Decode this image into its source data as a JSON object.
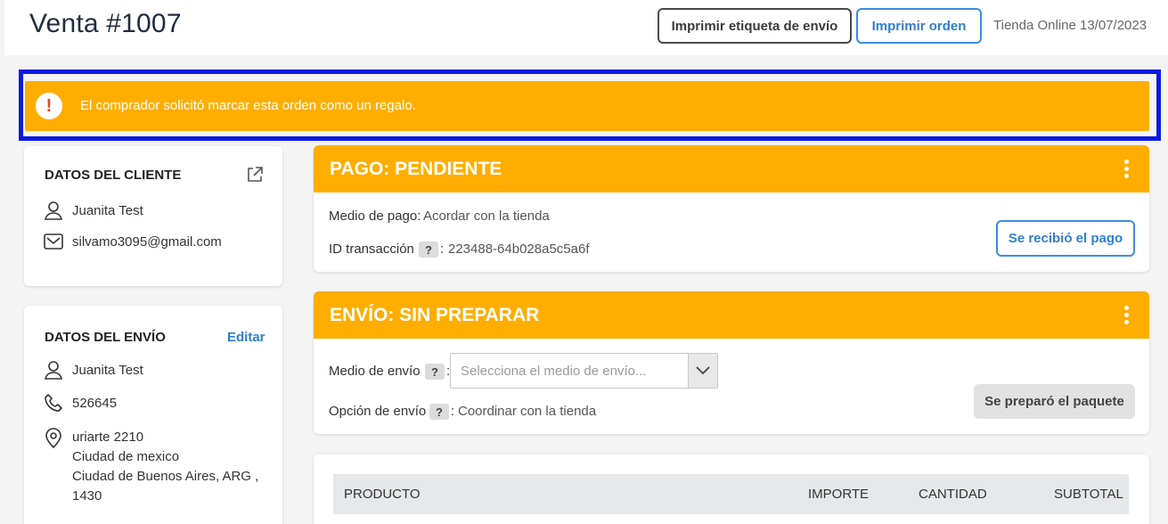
{
  "header": {
    "title": "Venta #1007",
    "print_label_button": "Imprimir etiqueta de envío",
    "print_order_button": "Imprimir orden",
    "store_date": "Tienda Online 13/07/2023"
  },
  "alert": {
    "icon": "!",
    "text": "El comprador solicitó marcar esta orden como un regalo."
  },
  "customer": {
    "heading": "DATOS DEL CLIENTE",
    "name": "Juanita Test",
    "email": "silvamo3095@gmail.com"
  },
  "shipping_data": {
    "heading": "DATOS DEL ENVÍO",
    "edit_link": "Editar",
    "name": "Juanita Test",
    "phone": "526645",
    "address_line1": "uriarte 2210",
    "address_line2": "Ciudad de mexico",
    "address_line3": "Ciudad de Buenos Aires, ARG ,",
    "address_line4": "1430"
  },
  "payment": {
    "title": "PAGO: PENDIENTE",
    "method_label": "Medio de pago:",
    "method_value": "Acordar con la tienda",
    "txn_label": "ID transacción",
    "help": "?",
    "colon": ":",
    "txn_value": "223488-64b028a5c5a6f",
    "received_button": "Se recibió el pago"
  },
  "shipment": {
    "title": "ENVÍO: SIN PREPARAR",
    "method_label": "Medio de envío",
    "help": "?",
    "colon": ":",
    "method_placeholder": "Selecciona el medio de envío...",
    "option_label": "Opción de envío",
    "option_value": "Coordinar con la tienda",
    "prepared_button": "Se preparó el paquete"
  },
  "products_table": {
    "headers": [
      "PRODUCTO",
      "IMPORTE",
      "CANTIDAD",
      "SUBTOTAL"
    ]
  },
  "colors": {
    "accent_orange": "#ffae00",
    "link_blue": "#2f7fd0",
    "focus_outline": "#0a1be0"
  }
}
